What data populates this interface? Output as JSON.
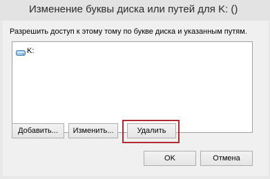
{
  "window": {
    "title": "Изменение буквы диска или путей для K: ()"
  },
  "dialog": {
    "prompt": "Разрешить доступ к этому тому по букве диска и указанным путям.",
    "list": {
      "items": [
        {
          "label": "K:",
          "icon": "drive-icon"
        }
      ]
    },
    "buttons": {
      "add_label": "Добавить...",
      "change_label": "Изменить...",
      "delete_label": "Удалить",
      "ok_label": "OK",
      "cancel_label": "Отмена"
    },
    "highlight_color": "#b3282e"
  }
}
